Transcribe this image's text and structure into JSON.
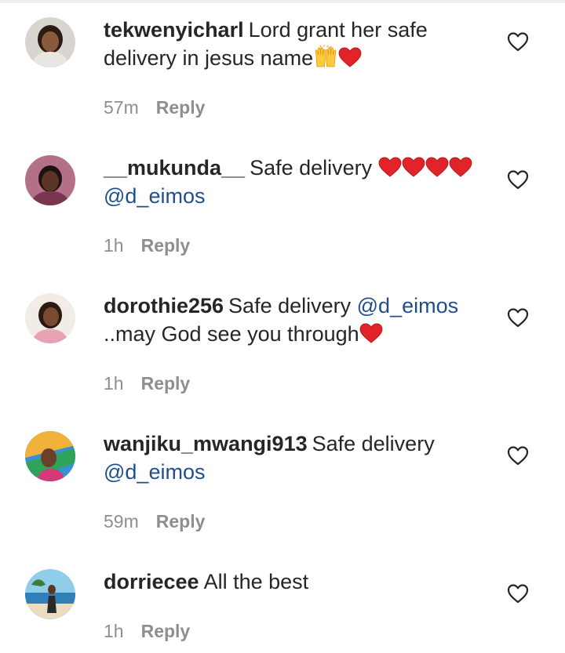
{
  "comments": [
    {
      "username": "tekwenyicharl",
      "text_1": "Lord grant her safe delivery in jesus name",
      "time": "57m",
      "reply_label": "Reply"
    },
    {
      "username": "__mukunda__",
      "text_1": "Safe delivery ",
      "mention": "@d_eimos",
      "time": "1h",
      "reply_label": "Reply"
    },
    {
      "username": "dorothie256",
      "text_1": "Safe delivery ",
      "mention": "@d_eimos",
      "text_2": " ..may God see you through",
      "time": "1h",
      "reply_label": "Reply"
    },
    {
      "username": "wanjiku_mwangi913",
      "text_1": "Safe delivery ",
      "mention": "@d_eimos",
      "time": "59m",
      "reply_label": "Reply"
    },
    {
      "username": "dorriecee",
      "text_1": "All the best",
      "time": "1h",
      "reply_label": "Reply"
    }
  ],
  "icons": {
    "like": "heart-outline-icon",
    "heart_emoji": "red-heart-emoji",
    "hands_emoji": "raising-hands-emoji"
  },
  "colors": {
    "username": "#262626",
    "body_text": "#262626",
    "mention": "#1f4e8c",
    "meta": "#8e8e8e",
    "heart_emoji": "#e0242a"
  }
}
